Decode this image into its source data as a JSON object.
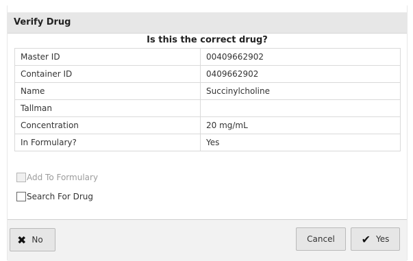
{
  "dialog": {
    "title": "Verify Drug",
    "question": "Is this the correct drug?"
  },
  "rows": [
    {
      "label": "Master ID",
      "value": "00409662902"
    },
    {
      "label": "Container ID",
      "value": "0409662902"
    },
    {
      "label": "Name",
      "value": "Succinylcholine"
    },
    {
      "label": "Tallman",
      "value": ""
    },
    {
      "label": "Concentration",
      "value": "20 mg/mL"
    },
    {
      "label": "In Formulary?",
      "value": "Yes"
    }
  ],
  "options": {
    "add_to_formulary": {
      "label": "Add To Formulary",
      "checked": false,
      "disabled": true
    },
    "search_for_drug": {
      "label": "Search For Drug",
      "checked": false,
      "disabled": false
    }
  },
  "buttons": {
    "no": "No",
    "cancel": "Cancel",
    "yes": "Yes"
  },
  "icons": {
    "no": "close-icon",
    "yes": "check-icon"
  }
}
